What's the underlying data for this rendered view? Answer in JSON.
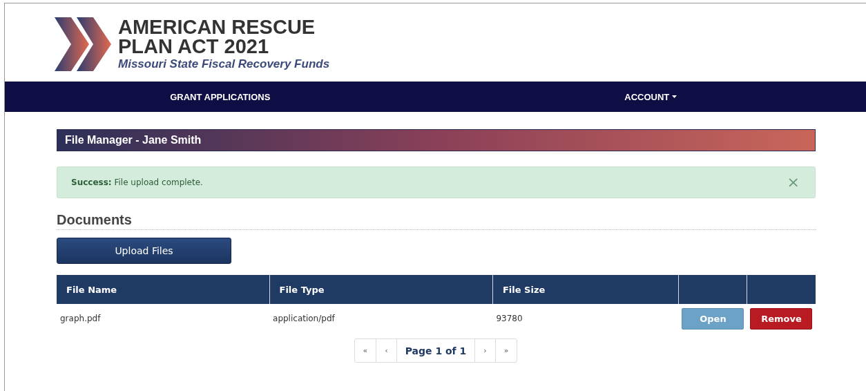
{
  "logo": {
    "line_1": "AMERICAN RESCUE",
    "line_2": "PLAN ACT 2021",
    "subtitle": "Missouri State Fiscal Recovery Funds"
  },
  "nav": [
    {
      "label": "GRANT APPLICATIONS",
      "dropdown": false
    },
    {
      "label": "ACCOUNT",
      "dropdown": true
    }
  ],
  "panel_title": "File Manager - Jane Smith",
  "alert": {
    "message": "**Success:** File upload complete.",
    "close": "×"
  },
  "documents": {
    "heading": "Documents",
    "upload_button": "Upload Files",
    "columns": [
      "File Name",
      "File Type",
      "File Size",
      "",
      ""
    ],
    "rows": [
      {
        "file_name": "graph.pdf",
        "file_type": "application/pdf",
        "file_size": "93780",
        "actions": [
          {
            "label": "Open",
            "kind": "open"
          },
          {
            "label": "Remove",
            "kind": "remove"
          }
        ]
      }
    ]
  },
  "pagination": [
    {
      "label": "«",
      "kind": "arrow"
    },
    {
      "label": "‹",
      "kind": "arrow"
    },
    {
      "label": "Page 1 of 1",
      "kind": "current"
    },
    {
      "label": "›",
      "kind": "arrow"
    },
    {
      "label": "»",
      "kind": "arrow"
    }
  ]
}
